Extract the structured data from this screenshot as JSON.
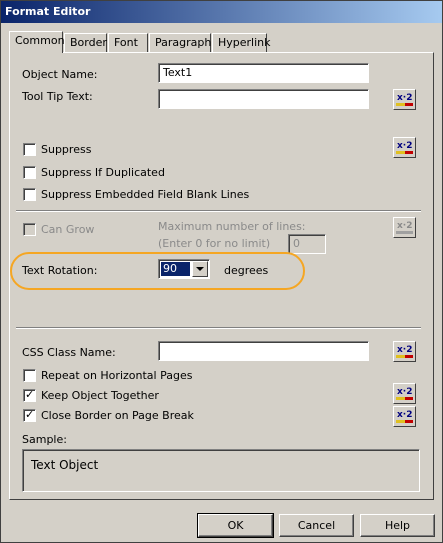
{
  "window": {
    "title": "Format Editor"
  },
  "tabs": [
    "Common",
    "Border",
    "Font",
    "Paragraph",
    "Hyperlink"
  ],
  "fields": {
    "object_name_label": "Object Name:",
    "object_name_value": "Text1",
    "tooltip_label": "Tool Tip Text:",
    "tooltip_value": "",
    "suppress": "Suppress",
    "suppress_if_duplicated": "Suppress If Duplicated",
    "suppress_blank_lines": "Suppress Embedded Field Blank Lines",
    "can_grow": "Can Grow",
    "max_lines_label": "Maximum number of lines:",
    "max_lines_hint": "(Enter 0 for no limit)",
    "max_lines_value": "0",
    "text_rotation_label": "Text Rotation:",
    "text_rotation_value": "90",
    "text_rotation_unit": "degrees",
    "css_class_label": "CSS Class Name:",
    "css_class_value": "",
    "repeat_horizontal": "Repeat on Horizontal Pages",
    "keep_together": "Keep Object Together",
    "close_border": "Close Border on Page Break",
    "sample_label": "Sample:",
    "sample_text": "Text Object"
  },
  "checkbox_states": {
    "suppress": false,
    "suppress_if_duplicated": false,
    "suppress_blank_lines": false,
    "can_grow": false,
    "repeat_horizontal": false,
    "keep_together": true,
    "close_border": true
  },
  "buttons": {
    "ok": "OK",
    "cancel": "Cancel",
    "help": "Help"
  },
  "colors": {
    "title_bar": "#0a246a",
    "dialog_bg": "#d4d0c8",
    "highlight_ring": "#f5a623"
  },
  "icons": {
    "formula_button": "formula-x2-icon"
  }
}
